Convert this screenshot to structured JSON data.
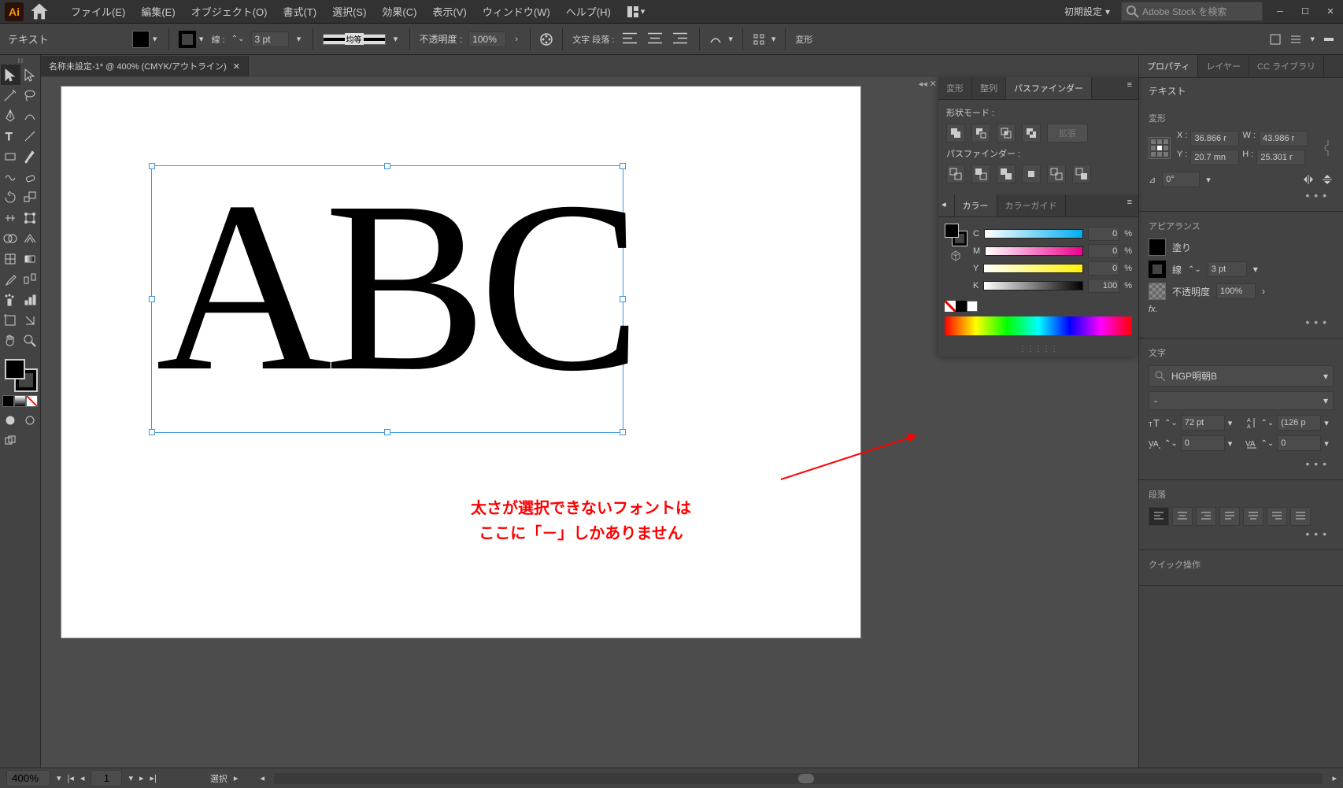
{
  "app": {
    "logo": "Ai"
  },
  "menu": {
    "file": "ファイル(E)",
    "edit": "編集(E)",
    "object": "オブジェクト(O)",
    "type": "書式(T)",
    "select": "選択(S)",
    "effect": "効果(C)",
    "view": "表示(V)",
    "window": "ウィンドウ(W)",
    "help": "ヘルプ(H)"
  },
  "titlebar": {
    "workspace": "初期設定",
    "search_placeholder": "Adobe Stock を検索"
  },
  "optionbar": {
    "context": "テキスト",
    "stroke_label": "線 :",
    "stroke_width": "3 pt",
    "stroke_profile": "均等",
    "opacity_label": "不透明度 :",
    "opacity": "100%",
    "char_para": "文字 段落 :",
    "transform": "変形"
  },
  "document": {
    "tab_title": "名称未設定-1* @ 400% (CMYK/アウトライン)",
    "canvas_text": "ABC"
  },
  "annotation": {
    "line1": "太さが選択できないフォントは",
    "line2": "ここに「－」しかありません"
  },
  "pathfinder_panel": {
    "tabs": {
      "transform": "変形",
      "align": "整列",
      "pathfinder": "パスファインダー"
    },
    "shape_mode": "形状モード :",
    "pathfinder_label": "パスファインダー :",
    "expand": "拡張"
  },
  "color_panel": {
    "tabs": {
      "color": "カラー",
      "guide": "カラーガイド"
    },
    "c_label": "C",
    "c_val": "0",
    "m_label": "M",
    "m_val": "0",
    "y_label": "Y",
    "y_val": "0",
    "k_label": "K",
    "k_val": "100",
    "pct": "%"
  },
  "properties": {
    "tabs": {
      "properties": "プロパティ",
      "layers": "レイヤー",
      "cclib": "CC ライブラリ"
    },
    "context": "テキスト",
    "transform_title": "変形",
    "x_label": "X :",
    "x_val": "36.866 r",
    "y_label": "Y :",
    "y_val": "20.7 mn",
    "w_label": "W :",
    "w_val": "43.986 r",
    "h_label": "H :",
    "h_val": "25.301 r",
    "rotate_val": "0°",
    "appearance_title": "アピアランス",
    "fill_label": "塗り",
    "stroke_label": "線",
    "stroke_val": "3 pt",
    "opacity_label": "不透明度",
    "opacity_val": "100%",
    "fx": "fx.",
    "char_title": "文字",
    "font_family": "HGP明朝B",
    "font_style": "-",
    "font_size": "72 pt",
    "leading": "(126 p",
    "kerning": "0",
    "tracking": "0",
    "para_title": "段落",
    "quick_title": "クイック操作"
  },
  "statusbar": {
    "zoom": "400%",
    "artboard_num": "1",
    "tool": "選択"
  }
}
